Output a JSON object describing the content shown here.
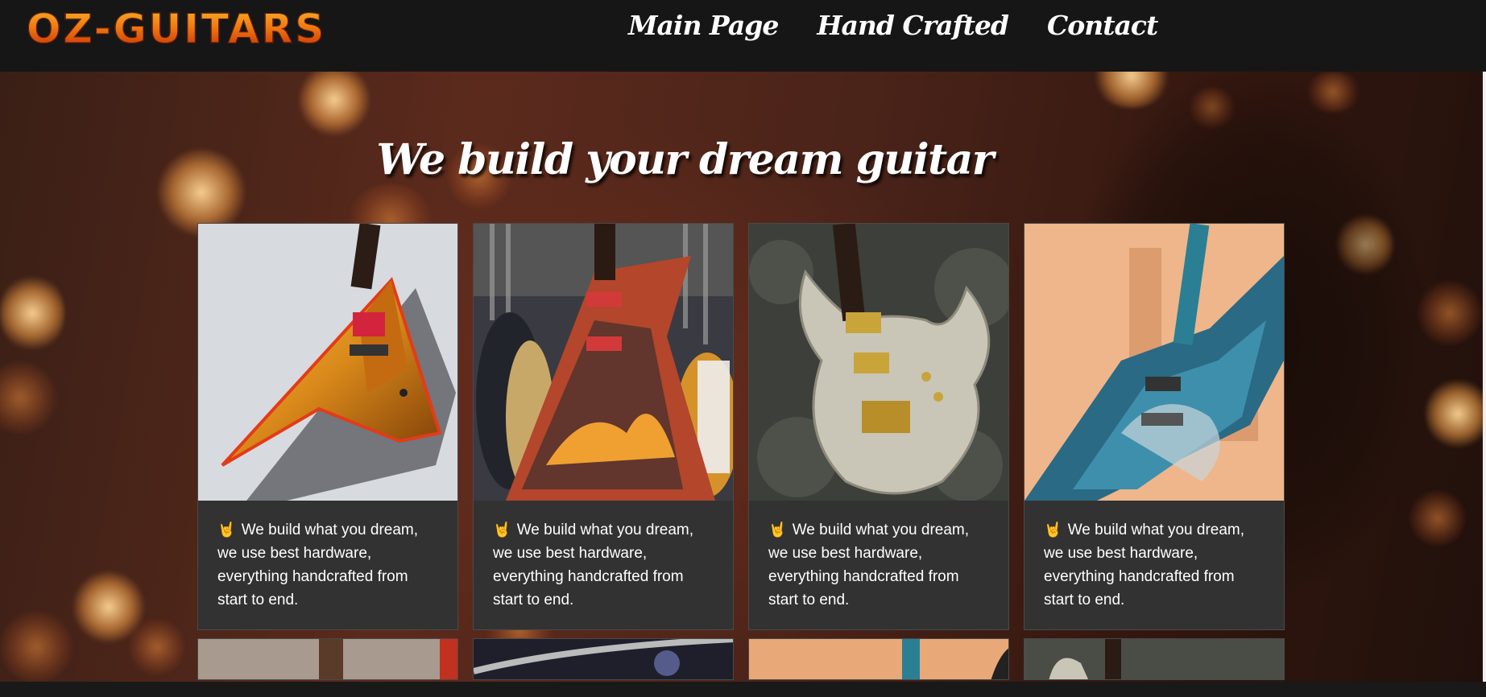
{
  "header": {
    "logo": "OZ-GUITARS",
    "nav": [
      "Main Page",
      "Hand Crafted",
      "Contact"
    ]
  },
  "hero": {
    "title": "We build your dream guitar"
  },
  "cards": [
    {
      "text": "We build what you dream, we use best hardware, everything handcrafted from start to end.",
      "icon": "rock-on-hand-icon"
    },
    {
      "text": "We build what you dream, we use best hardware, everything handcrafted from start to end.",
      "icon": "rock-on-hand-icon"
    },
    {
      "text": "We build what you dream, we use best hardware, everything handcrafted from start to end.",
      "icon": "rock-on-hand-icon"
    },
    {
      "text": "We build what you dream, we use best hardware, everything handcrafted from start to end.",
      "icon": "rock-on-hand-icon"
    }
  ],
  "colors": {
    "header_bg": "#161616",
    "card_bg": "#323232",
    "logo_orange": "#f07a12",
    "logo_red": "#c52a06"
  }
}
